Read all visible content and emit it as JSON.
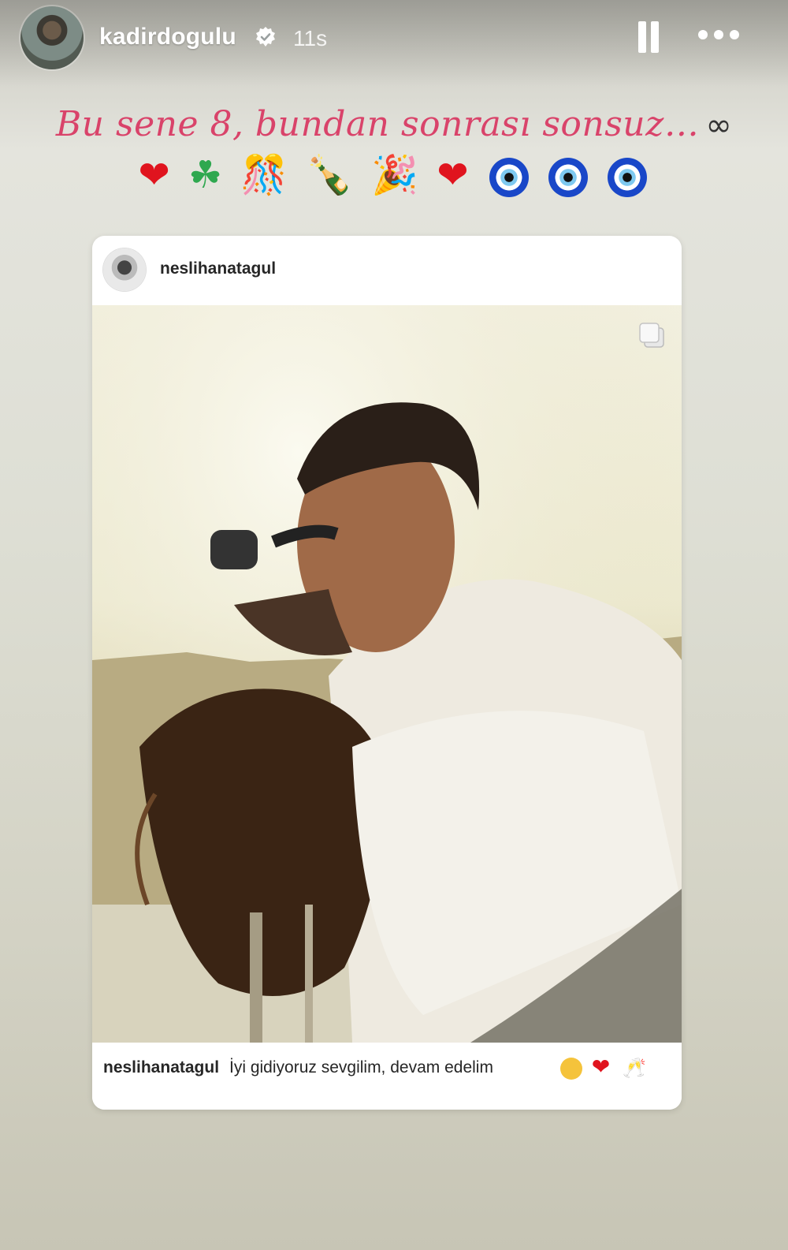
{
  "story": {
    "username": "kadirdogulu",
    "time": "11s",
    "verified": true,
    "pause_icon": "pause-icon",
    "more_icon": "more-icon"
  },
  "caption": {
    "text": "Bu sene 8, bundan sonrası sonsuz…",
    "infinity": "∞",
    "emojis": [
      "❤",
      "☘",
      "🎊",
      "🍾",
      "🎉",
      "❤",
      "🧿",
      "🧿",
      "🧿"
    ]
  },
  "post": {
    "username": "neslihanatagul",
    "multi_icon": "carousel-icon",
    "caption_user": "neslihanatagul",
    "caption_text": "İyi gidiyoruz sevgilim, devam edelim",
    "caption_emojis": [
      "😉",
      "❤",
      "🥂"
    ]
  },
  "colors": {
    "caption": "#d9436a",
    "heart": "#e0141e",
    "evil_eye": "#1947c8"
  }
}
